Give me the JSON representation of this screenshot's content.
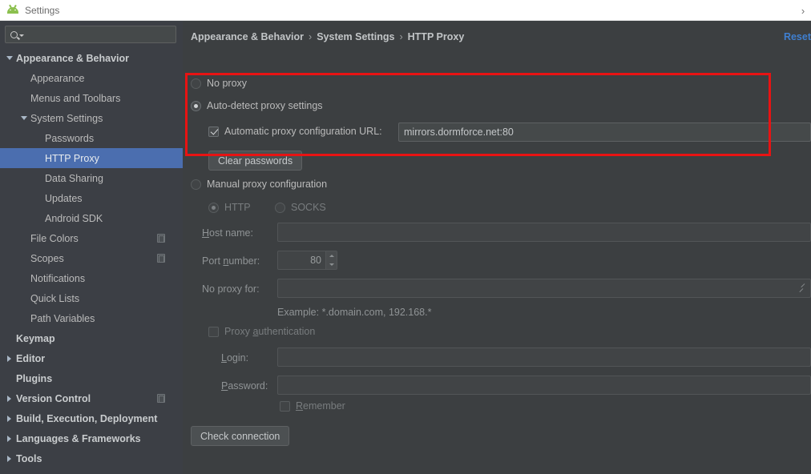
{
  "window": {
    "title": "Settings",
    "app_icon": "android-icon",
    "chevron": "›"
  },
  "sidebar": {
    "search": {
      "placeholder": "",
      "value": "",
      "icon": "search-icon"
    },
    "items": [
      {
        "label": "Appearance & Behavior",
        "indent": 1,
        "twisty": "down",
        "bold": true,
        "selected": false,
        "scope_icon": false
      },
      {
        "label": "Appearance",
        "indent": 2,
        "twisty": "none",
        "bold": false,
        "selected": false,
        "scope_icon": false
      },
      {
        "label": "Menus and Toolbars",
        "indent": 2,
        "twisty": "none",
        "bold": false,
        "selected": false,
        "scope_icon": false
      },
      {
        "label": "System Settings",
        "indent": 2,
        "twisty": "down",
        "bold": false,
        "selected": false,
        "scope_icon": false
      },
      {
        "label": "Passwords",
        "indent": 3,
        "twisty": "none",
        "bold": false,
        "selected": false,
        "scope_icon": false
      },
      {
        "label": "HTTP Proxy",
        "indent": 3,
        "twisty": "none",
        "bold": false,
        "selected": true,
        "scope_icon": false
      },
      {
        "label": "Data Sharing",
        "indent": 3,
        "twisty": "none",
        "bold": false,
        "selected": false,
        "scope_icon": false
      },
      {
        "label": "Updates",
        "indent": 3,
        "twisty": "none",
        "bold": false,
        "selected": false,
        "scope_icon": false
      },
      {
        "label": "Android SDK",
        "indent": 3,
        "twisty": "none",
        "bold": false,
        "selected": false,
        "scope_icon": false
      },
      {
        "label": "File Colors",
        "indent": 2,
        "twisty": "none",
        "bold": false,
        "selected": false,
        "scope_icon": true
      },
      {
        "label": "Scopes",
        "indent": 2,
        "twisty": "none",
        "bold": false,
        "selected": false,
        "scope_icon": true
      },
      {
        "label": "Notifications",
        "indent": 2,
        "twisty": "none",
        "bold": false,
        "selected": false,
        "scope_icon": false
      },
      {
        "label": "Quick Lists",
        "indent": 2,
        "twisty": "none",
        "bold": false,
        "selected": false,
        "scope_icon": false
      },
      {
        "label": "Path Variables",
        "indent": 2,
        "twisty": "none",
        "bold": false,
        "selected": false,
        "scope_icon": false
      },
      {
        "label": "Keymap",
        "indent": 1,
        "twisty": "none",
        "bold": true,
        "selected": false,
        "scope_icon": false
      },
      {
        "label": "Editor",
        "indent": 1,
        "twisty": "right",
        "bold": true,
        "selected": false,
        "scope_icon": false
      },
      {
        "label": "Plugins",
        "indent": 1,
        "twisty": "none",
        "bold": true,
        "selected": false,
        "scope_icon": false
      },
      {
        "label": "Version Control",
        "indent": 1,
        "twisty": "right",
        "bold": true,
        "selected": false,
        "scope_icon": true
      },
      {
        "label": "Build, Execution, Deployment",
        "indent": 1,
        "twisty": "right",
        "bold": true,
        "selected": false,
        "scope_icon": false
      },
      {
        "label": "Languages & Frameworks",
        "indent": 1,
        "twisty": "right",
        "bold": true,
        "selected": false,
        "scope_icon": false
      },
      {
        "label": "Tools",
        "indent": 1,
        "twisty": "right",
        "bold": true,
        "selected": false,
        "scope_icon": false
      }
    ]
  },
  "main": {
    "breadcrumb": {
      "part1": "Appearance & Behavior",
      "part2": "System Settings",
      "part3": "HTTP Proxy",
      "separator": "›"
    },
    "reset_label": "Reset",
    "no_proxy_label": "No proxy",
    "auto_detect_label": "Auto-detect proxy settings",
    "auto_config_url_label": "Automatic proxy configuration URL:",
    "auto_config_url_value": "mirrors.dormforce.net:80",
    "clear_passwords_label": "Clear passwords",
    "manual_proxy_label": "Manual proxy configuration",
    "http_label": "HTTP",
    "socks_label": "SOCKS",
    "host_name_label": "Host name:",
    "host_name_value": "",
    "port_number_label": "Port number:",
    "port_number_value": "80",
    "no_proxy_for_label": "No proxy for:",
    "no_proxy_for_value": "",
    "example_hint": "Example: *.domain.com, 192.168.*",
    "proxy_auth_label": "Proxy authentication",
    "login_label": "Login:",
    "login_value": "",
    "password_label": "Password:",
    "password_value": "",
    "remember_label": "Remember",
    "check_connection_label": "Check connection"
  },
  "annotation": {
    "highlight_color": "#e81313"
  }
}
